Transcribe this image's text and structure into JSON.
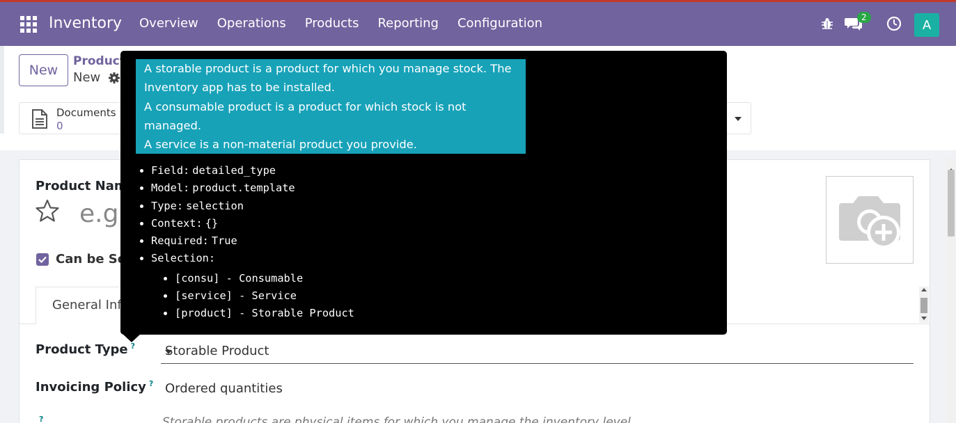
{
  "navbar": {
    "app_name": "Inventory",
    "menu": [
      "Overview",
      "Operations",
      "Products",
      "Reporting",
      "Configuration"
    ],
    "chat_count": "2",
    "avatar_letter": "A"
  },
  "control": {
    "new_label": "New",
    "breadcrumb": "Product",
    "record_name": "New",
    "documents_label": "Documents",
    "documents_count": "0"
  },
  "form": {
    "product_name_label": "Product Name",
    "product_name_placeholder": "e.g.",
    "can_be_sold_label": "Can be Sold",
    "tab_general": "General Information",
    "product_type_label": "Product Type",
    "product_type_value": "Storable Product",
    "invoicing_policy_label": "Invoicing Policy",
    "invoicing_policy_value": "Ordered quantities",
    "help_marker": "?",
    "storable_note": "Storable products are physical items for which you manage the inventory level."
  },
  "tooltip": {
    "help_lines": [
      "A storable product is a product for which you manage stock. The",
      "Inventory app has to be installed.",
      "A consumable product is a product for which stock is not",
      "managed.",
      "A service is a non-material product you provide."
    ],
    "meta": [
      {
        "key": "Field:",
        "value": "detailed_type"
      },
      {
        "key": "Model:",
        "value": "product.template"
      },
      {
        "key": "Type:",
        "value": "selection"
      },
      {
        "key": "Context:",
        "value": "{}"
      },
      {
        "key": "Required:",
        "value": "True"
      },
      {
        "key": "Selection:",
        "value": ""
      }
    ],
    "selection": [
      "[consu] - Consumable",
      "[service] - Service",
      "[product] - Storable Product"
    ]
  },
  "colors": {
    "brand": "#71639e",
    "help_bg": "#17a2b8",
    "badge": "#28a745",
    "avatar": "#1ab1a4"
  }
}
